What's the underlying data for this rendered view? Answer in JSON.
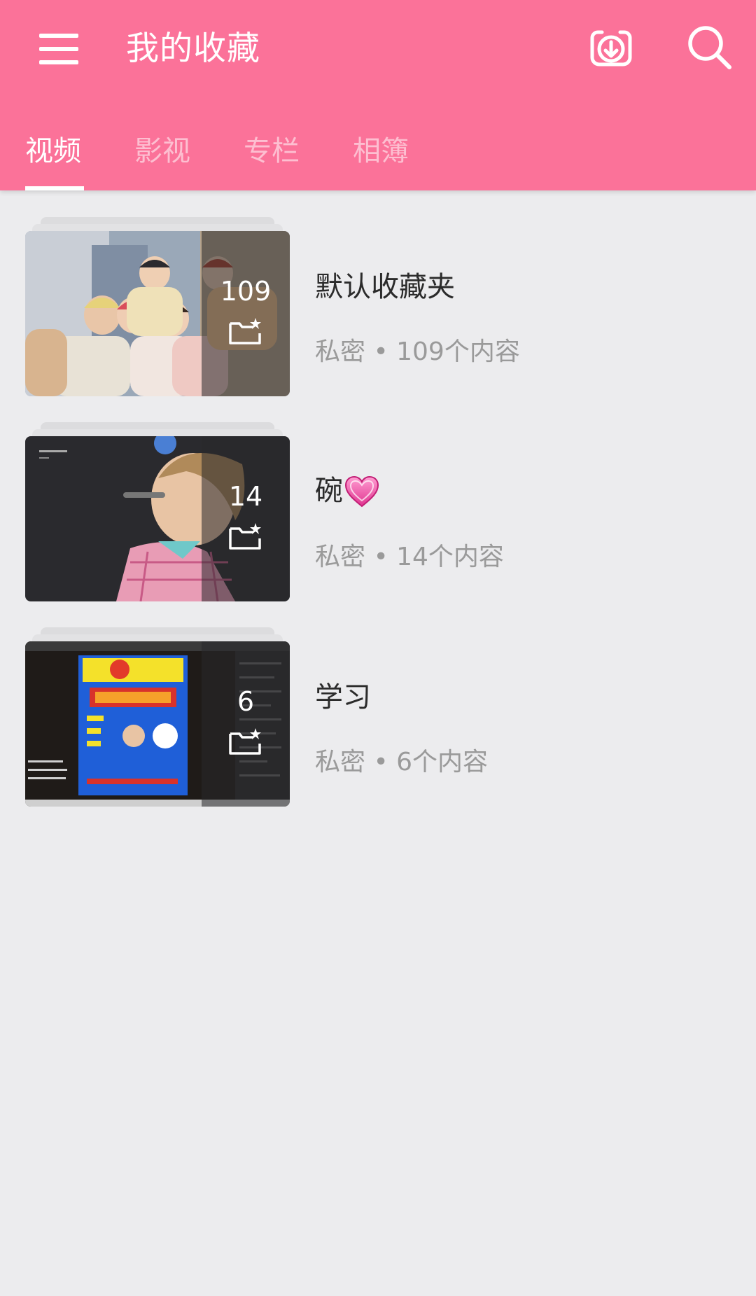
{
  "header": {
    "title": "我的收藏",
    "menu_icon": "hamburger-menu-icon",
    "download_icon": "download-icon",
    "search_icon": "search-icon",
    "accent_color": "#fb7299"
  },
  "tabs": [
    {
      "label": "视频",
      "active": true
    },
    {
      "label": "影视",
      "active": false
    },
    {
      "label": "专栏",
      "active": false
    },
    {
      "label": "相簿",
      "active": false
    }
  ],
  "folders": [
    {
      "name": "默认收藏夹",
      "meta": "私密 • 109个内容",
      "count": "109"
    },
    {
      "name": "碗",
      "name_emoji": "heart-icon",
      "meta": "私密 • 14个内容",
      "count": "14"
    },
    {
      "name": "学习",
      "meta": "私密 • 6个内容",
      "count": "6"
    }
  ]
}
